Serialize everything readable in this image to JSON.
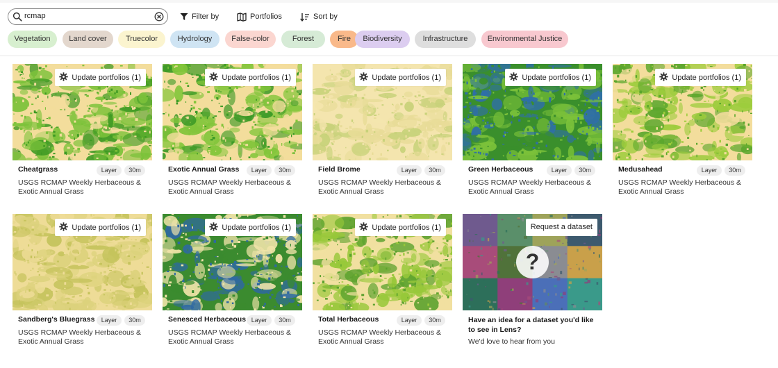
{
  "search": {
    "value": "rcmap",
    "icon": "search-icon",
    "clear_icon": "clear-icon"
  },
  "toolbar": {
    "filter_label": "Filter by",
    "portfolios_label": "Portfolios",
    "sort_label": "Sort by"
  },
  "chips": [
    {
      "label": "Vegetation",
      "color": "#d7efcf"
    },
    {
      "label": "Land cover",
      "color": "#e3d7cd"
    },
    {
      "label": "Truecolor",
      "color": "#fbf4cf"
    },
    {
      "label": "Hydrology",
      "color": "#cfe4f3"
    },
    {
      "label": "False-color",
      "color": "#fbd6d0"
    },
    {
      "label": "Forest",
      "color": "#d6ebd6"
    },
    {
      "label": "Fire",
      "color": "#f9b98a"
    },
    {
      "label": "Biodiversity",
      "color": "#dccdf0"
    },
    {
      "label": "Infrastructure",
      "color": "#dedede"
    },
    {
      "label": "Environmental Justice",
      "color": "#f8c8cf"
    }
  ],
  "cards": [
    {
      "title": "Cheatgrass",
      "badge_type": "Layer",
      "badge_res": "30m",
      "subtitle": "USGS RCMAP Weekly Herbaceous & Exotic Annual Grass",
      "action": "Update portfolios (1)",
      "palette": [
        "#f3dd9c",
        "#7cc23a",
        "#3f9a24"
      ],
      "scheme": "green"
    },
    {
      "title": "Exotic Annual Grass",
      "badge_type": "Layer",
      "badge_res": "30m",
      "subtitle": "USGS RCMAP Weekly Herbaceous & Exotic Annual Grass",
      "action": "Update portfolios (1)",
      "palette": [
        "#f3dd9c",
        "#82c53a",
        "#3c9a26"
      ],
      "scheme": "green"
    },
    {
      "title": "Field Brome",
      "badge_type": "Layer",
      "badge_res": "30m",
      "subtitle": "USGS RCMAP Weekly Herbaceous & Exotic Annual Grass",
      "action": "Update portfolios (1)",
      "palette": [
        "#f4e5ae",
        "#e8dc98",
        "#c8d27a"
      ],
      "scheme": "pale"
    },
    {
      "title": "Green Herbaceous",
      "badge_type": "Layer",
      "badge_res": "30m",
      "subtitle": "USGS RCMAP Weekly Herbaceous & Exotic Annual Grass",
      "action": "Update portfolios (1)",
      "palette": [
        "#3a8f2c",
        "#7cc23a",
        "#2f6fa8"
      ],
      "scheme": "blue"
    },
    {
      "title": "Medusahead",
      "badge_type": "Layer",
      "badge_res": "30m",
      "subtitle": "USGS RCMAP Weekly Herbaceous & Exotic Annual Grass",
      "action": "Update portfolios (1)",
      "palette": [
        "#f3dd9c",
        "#9ccc3c",
        "#5aa62c"
      ],
      "scheme": "green"
    },
    {
      "title": "Sandberg's Bluegrass",
      "badge_type": "Layer",
      "badge_res": "30m",
      "subtitle": "USGS RCMAP Weekly Herbaceous & Exotic Annual Grass",
      "action": "Update portfolios (1)",
      "palette": [
        "#eedc97",
        "#dcd27c",
        "#c5c35c"
      ],
      "scheme": "pale"
    },
    {
      "title": "Senesced Herbaceous",
      "badge_type": "Layer",
      "badge_res": "30m",
      "subtitle": "USGS RCMAP Weekly Herbaceous & Exotic Annual Grass",
      "action": "Update portfolios (1)",
      "palette": [
        "#3b8b2f",
        "#efe3a8",
        "#2e68a3"
      ],
      "scheme": "blue"
    },
    {
      "title": "Total Herbaceous",
      "badge_type": "Layer",
      "badge_res": "30m",
      "subtitle": "USGS RCMAP Weekly Herbaceous & Exotic Annual Grass",
      "action": "Update portfolios (1)",
      "palette": [
        "#f1e0a0",
        "#98c83a",
        "#5da22e"
      ],
      "scheme": "green"
    }
  ],
  "request": {
    "label": "Request a dataset",
    "title": "Have an idea for a dataset you'd like to see in Lens?",
    "subtitle": "We'd love to hear from you",
    "question_mark": "?",
    "mosaic_colors": [
      "#6f5a8e",
      "#5a8f6a",
      "#9ea35a",
      "#3d5a6e",
      "#a84c7a",
      "#50723a",
      "#8a8c92",
      "#c9a04a",
      "#2d6f5a",
      "#8f3f7a",
      "#4b6fb8",
      "#3a9a8a"
    ]
  }
}
